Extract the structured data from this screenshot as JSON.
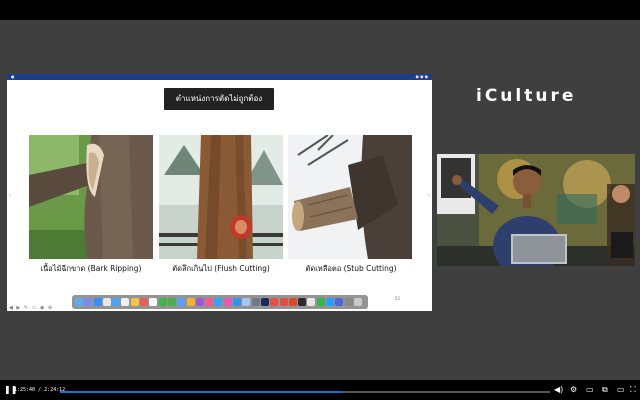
{
  "brand": "iCulture",
  "slide": {
    "title": "ตำแหน่งการตัดไม่ถูกต้อง",
    "page_number": "55",
    "items": [
      {
        "caption": "เนื้อไม้ฉีกขาด (Bark Ripping)"
      },
      {
        "caption": "ตัดลึกเกินไป (Flush Cutting)"
      },
      {
        "caption": "ตัดเหลือตอ (Stub Cutting)"
      }
    ],
    "dock_colors": [
      "#5ea9f5",
      "#7a8cf0",
      "#3b8ef3",
      "#e8e8e8",
      "#4aa3f3",
      "#f0f0f0",
      "#f6c342",
      "#e85d5d",
      "#ffffff",
      "#42b34b",
      "#48b04c",
      "#5aa0f5",
      "#f2b233",
      "#9b59d6",
      "#f05a8d",
      "#3aa0f0",
      "#e45ab4",
      "#2d95f0",
      "#a7c6f5",
      "#6e7a86",
      "#1b2a5b",
      "#e2523d",
      "#e34f3e",
      "#d94b2b",
      "#2b2b2b",
      "#e6e6e6",
      "#36b34a",
      "#2a9df4",
      "#4b67d8",
      "#888888",
      "#c9c9c9"
    ]
  },
  "player": {
    "time": "1:25:40 / 2:24:12",
    "progress": 0.575
  }
}
